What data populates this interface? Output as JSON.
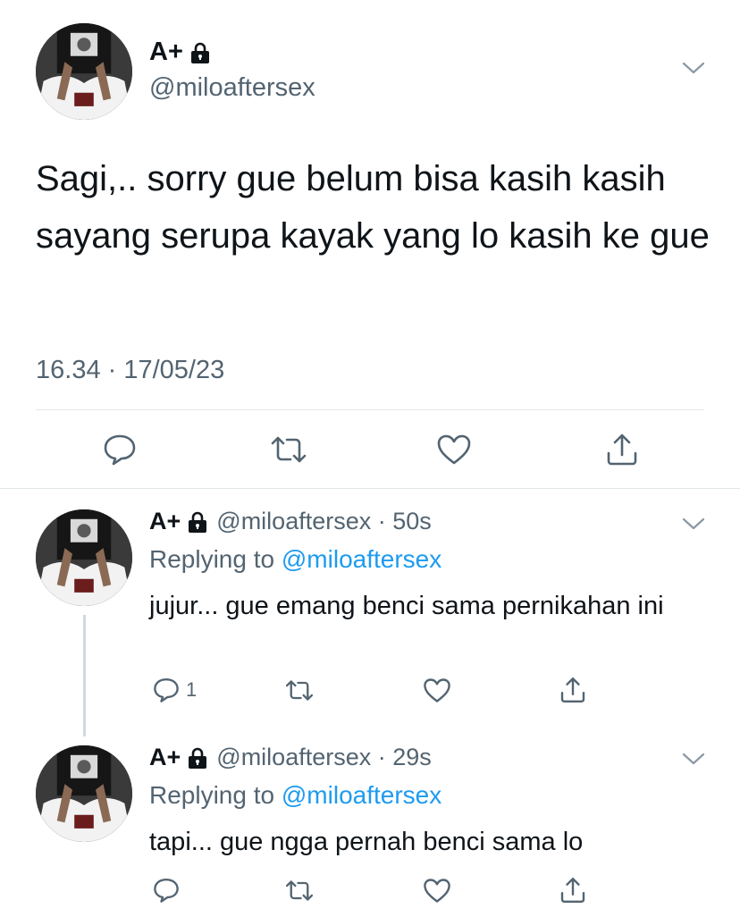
{
  "main_tweet": {
    "display_name": "A+",
    "handle": "@miloaftersex",
    "text": "Sagi,.. sorry gue belum bisa kasih kasih sayang serupa kayak yang lo kasih ke gue",
    "timestamp": "16.34 · 17/05/23"
  },
  "replies": [
    {
      "display_name": "A+",
      "handle_time": "@miloaftersex · 50s",
      "replying_label": "Replying to ",
      "replying_to": "@miloaftersex",
      "text": "jujur... gue emang benci sama pernikahan ini",
      "reply_count": "1"
    },
    {
      "display_name": "A+",
      "handle_time": "@miloaftersex · 29s",
      "replying_label": "Replying to ",
      "replying_to": "@miloaftersex",
      "text": "tapi... gue ngga pernah benci sama lo",
      "reply_count": ""
    }
  ],
  "icons": {
    "reply": "speech-bubble-icon",
    "retweet": "retweet-arrows-icon",
    "like": "heart-icon",
    "share": "share-upload-icon",
    "lock": "lock-icon",
    "more": "chevron-down-icon"
  },
  "colors": {
    "text": "#0f1419",
    "secondary": "#536471",
    "link": "#1d9bf0",
    "divider": "#e1e6ea"
  }
}
